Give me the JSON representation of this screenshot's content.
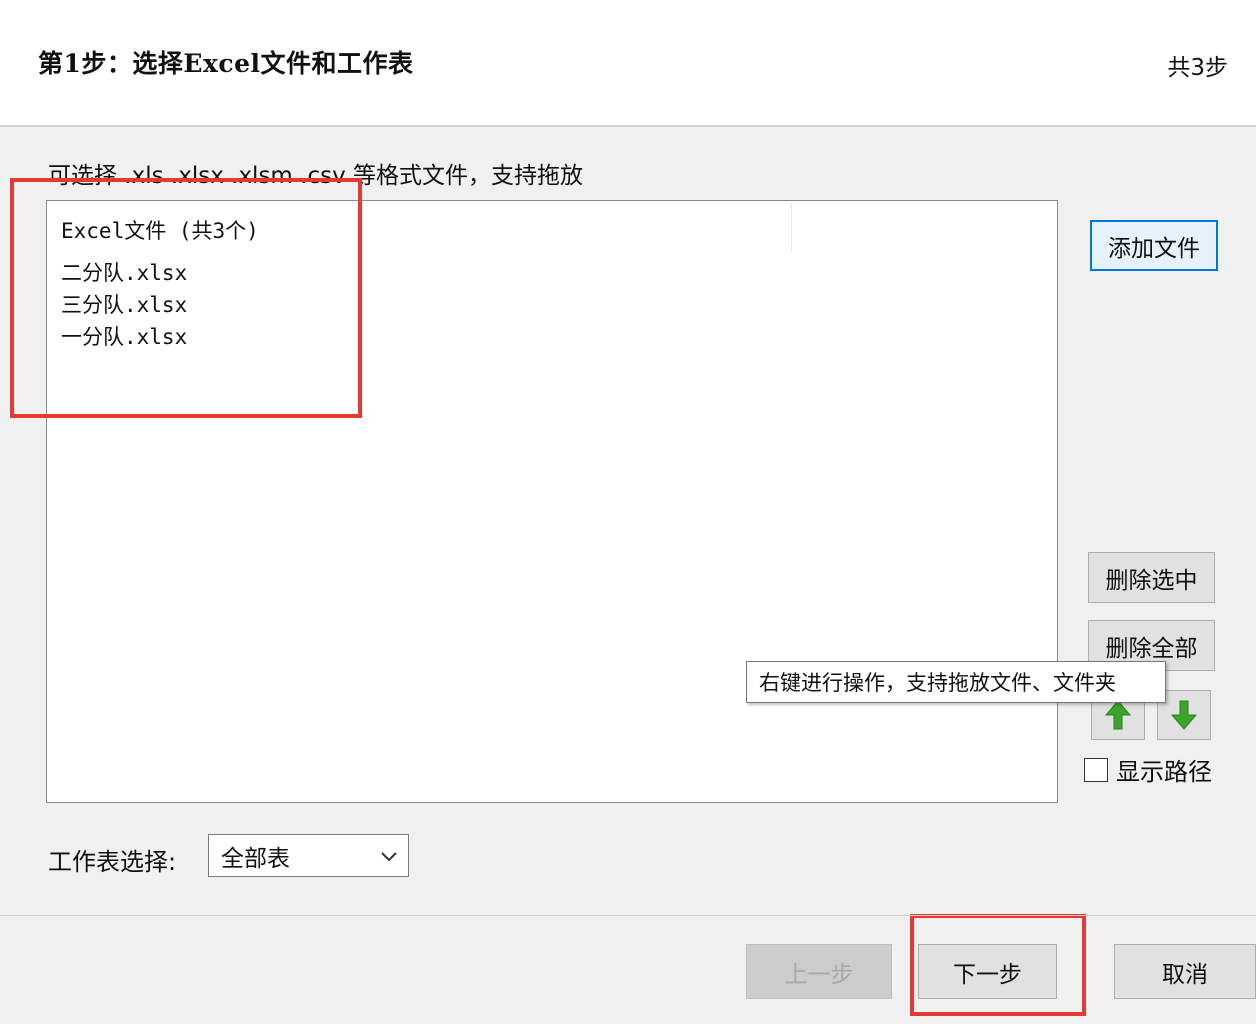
{
  "header": {
    "title": "第1步：选择Excel文件和工作表",
    "steps": "共3步"
  },
  "hint": "可选择 .xls .xlsx .xlsm .csv 等格式文件，支持拖放",
  "file_list": {
    "header": "Excel文件 (共3个)",
    "items": [
      "二分队.xlsx",
      "三分队.xlsx",
      "一分队.xlsx"
    ]
  },
  "buttons": {
    "add_file": "添加文件",
    "delete_selected": "删除选中",
    "delete_all": "删除全部",
    "prev": "上一步",
    "next": "下一步",
    "cancel": "取消"
  },
  "tooltip": "右键进行操作，支持拖放文件、文件夹",
  "show_path": {
    "label": "显示路径",
    "checked": false
  },
  "sheet": {
    "label": "工作表选择:",
    "selected": "全部表"
  },
  "colors": {
    "accent": "#0078d7",
    "highlight": "#e53935",
    "arrow_green": "#3aa52a"
  }
}
